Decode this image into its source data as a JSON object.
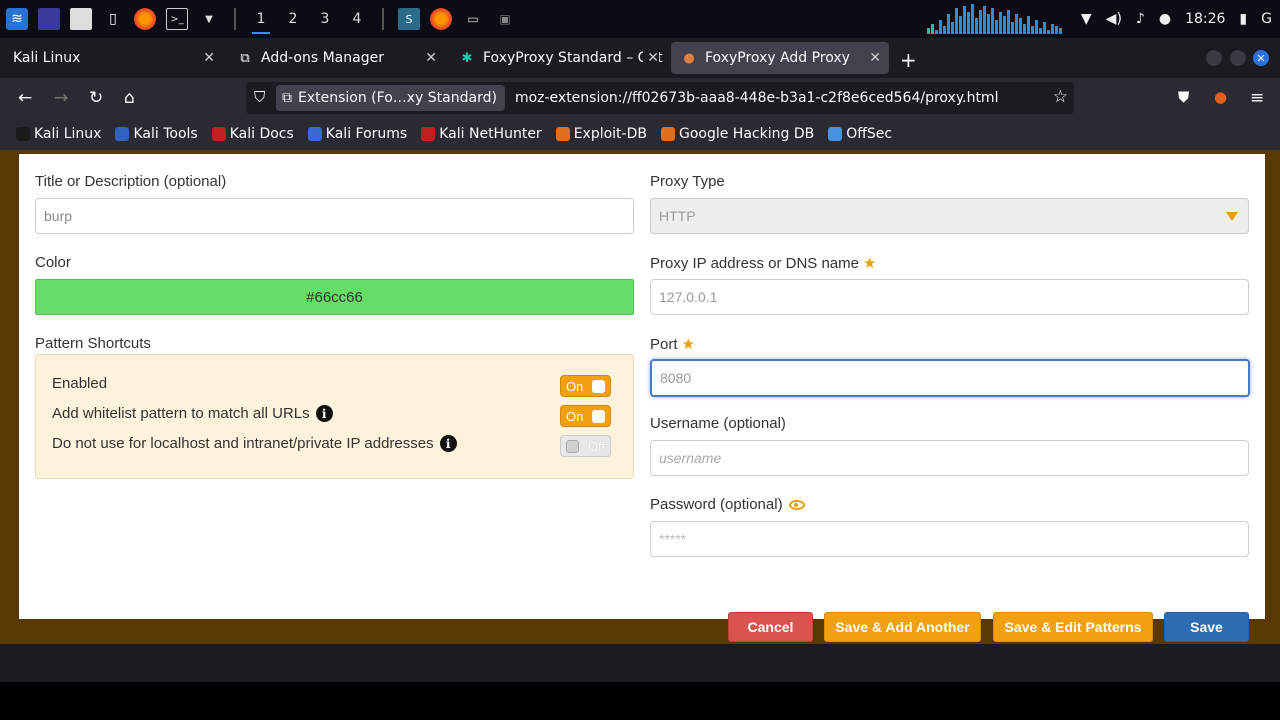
{
  "taskbar": {
    "workspaces": [
      "1",
      "2",
      "3",
      "4"
    ],
    "clock": "18:26"
  },
  "tabs": [
    {
      "label": "Kali Linux"
    },
    {
      "label": "Add-ons Manager"
    },
    {
      "label": "FoxyProxy Standard – Get"
    },
    {
      "label": "FoxyProxy Add Proxy"
    }
  ],
  "urlbar": {
    "extension_label": "Extension (Fo…xy Standard)",
    "url": "moz-extension://ff02673b-aaa8-448e-b3a1-c2f8e6ced564/proxy.html"
  },
  "bookmarks": [
    {
      "label": "Kali Linux",
      "color": "#1a1a1a"
    },
    {
      "label": "Kali Tools",
      "color": "#3060c0"
    },
    {
      "label": "Kali Docs",
      "color": "#c02020"
    },
    {
      "label": "Kali Forums",
      "color": "#3a6ad0"
    },
    {
      "label": "Kali NetHunter",
      "color": "#c02020"
    },
    {
      "label": "Exploit-DB",
      "color": "#e07020"
    },
    {
      "label": "Google Hacking DB",
      "color": "#e07020"
    },
    {
      "label": "OffSec",
      "color": "#4a90e0"
    }
  ],
  "form": {
    "title_label": "Title or Description (optional)",
    "title_value": "burp",
    "color_label": "Color",
    "color_value": "#66cc66",
    "pattern_label": "Pattern Shortcuts",
    "shortcuts": [
      {
        "label": "Enabled",
        "state": "On"
      },
      {
        "label": "Add whitelist pattern to match all URLs",
        "state": "On"
      },
      {
        "label": "Do not use for localhost and intranet/private IP addresses",
        "state": "Off"
      }
    ],
    "proxy_type_label": "Proxy Type",
    "proxy_type_value": "HTTP",
    "ip_label": "Proxy IP address or DNS name",
    "ip_value": "127.0.0.1",
    "port_label": "Port",
    "port_value": "8080",
    "username_label": "Username (optional)",
    "username_placeholder": "username",
    "password_label": "Password (optional)",
    "password_placeholder": "*****"
  },
  "buttons": {
    "cancel": "Cancel",
    "save_add": "Save & Add Another",
    "save_edit": "Save & Edit Patterns",
    "save": "Save"
  },
  "colors": {
    "cancel": "#d9534f",
    "save_secondary": "#f0a010",
    "save": "#2e6db4"
  },
  "icons": [
    "kali-menu-icon",
    "shield-icon",
    "star-icon",
    "eye-icon",
    "info-icon"
  ]
}
